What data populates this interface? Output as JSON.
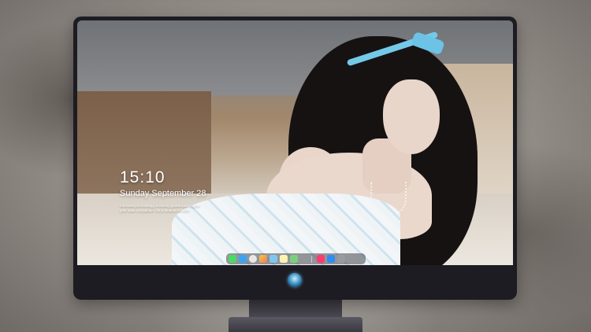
{
  "lockscreen": {
    "time": "15:10",
    "date": "Sunday September 28",
    "tagline": "Innovating technology, Ensuring global sourcing for your ideal companion / for a smarter lifestyle"
  },
  "dock": {
    "icons": [
      {
        "name": "messages",
        "color": "#4cd964"
      },
      {
        "name": "finder",
        "color": "#3da4f5"
      },
      {
        "name": "safari",
        "color": "#e8e8e8"
      },
      {
        "name": "photos",
        "color": "#f5c842"
      },
      {
        "name": "mail",
        "color": "#7ec8f0"
      },
      {
        "name": "notes",
        "color": "#fff3b0"
      },
      {
        "name": "maps",
        "color": "#7ad07a"
      },
      {
        "name": "music",
        "color": "#fc3c6b"
      },
      {
        "name": "app-store",
        "color": "#2f8cf5"
      },
      {
        "name": "camera",
        "color": "#9a9aa2"
      }
    ]
  },
  "colors": {
    "monitor_frame": "#1d1c22",
    "text": "#ffffff",
    "logo_glow": "#2d87b8"
  }
}
